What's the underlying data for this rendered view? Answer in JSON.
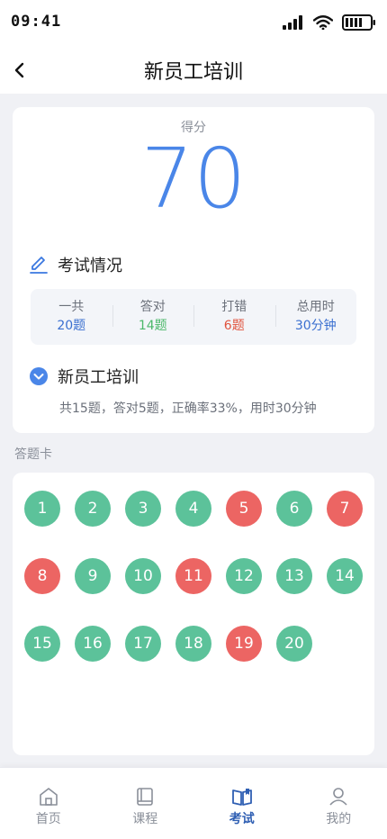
{
  "status_bar": {
    "time": "09:41"
  },
  "nav": {
    "title": "新员工培训"
  },
  "score": {
    "label": "得分",
    "value": "70"
  },
  "exam": {
    "title": "考试情况",
    "stats": [
      {
        "label": "一共",
        "value": "20题",
        "color": "#3a6fd0"
      },
      {
        "label": "答对",
        "value": "14题",
        "color": "#4cb86a"
      },
      {
        "label": "打错",
        "value": "6题",
        "color": "#e0533e"
      },
      {
        "label": "总用时",
        "value": "30分钟",
        "color": "#3a6fd0"
      }
    ]
  },
  "course": {
    "title": "新员工培训",
    "summary": "共15题，答对5题，正确率33%，用时30分钟"
  },
  "answer_card": {
    "label": "答题卡",
    "questions": [
      {
        "n": "1",
        "state": "correct"
      },
      {
        "n": "2",
        "state": "correct"
      },
      {
        "n": "3",
        "state": "correct"
      },
      {
        "n": "4",
        "state": "correct"
      },
      {
        "n": "5",
        "state": "wrong"
      },
      {
        "n": "6",
        "state": "correct"
      },
      {
        "n": "7",
        "state": "wrong"
      },
      {
        "n": "8",
        "state": "wrong"
      },
      {
        "n": "9",
        "state": "correct"
      },
      {
        "n": "10",
        "state": "correct"
      },
      {
        "n": "11",
        "state": "wrong"
      },
      {
        "n": "12",
        "state": "correct"
      },
      {
        "n": "13",
        "state": "correct"
      },
      {
        "n": "14",
        "state": "correct"
      },
      {
        "n": "15",
        "state": "correct"
      },
      {
        "n": "16",
        "state": "correct"
      },
      {
        "n": "17",
        "state": "correct"
      },
      {
        "n": "18",
        "state": "correct"
      },
      {
        "n": "19",
        "state": "wrong"
      },
      {
        "n": "20",
        "state": "correct"
      }
    ]
  },
  "tabs": [
    {
      "label": "首页",
      "icon": "home-icon",
      "active": false
    },
    {
      "label": "课程",
      "icon": "book-icon",
      "active": false
    },
    {
      "label": "考试",
      "icon": "open-book-icon",
      "active": true
    },
    {
      "label": "我的",
      "icon": "user-icon",
      "active": false
    }
  ]
}
